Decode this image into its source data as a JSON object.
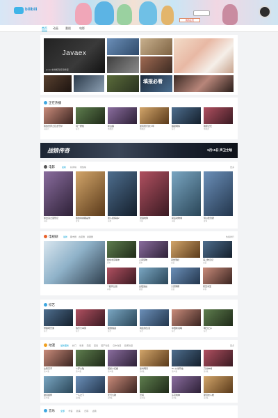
{
  "brand": {
    "logo_text": "bilibili",
    "user_badge": "我的主页"
  },
  "nav": {
    "tabs": [
      "首页",
      "动画",
      "番剧",
      "电影"
    ]
  },
  "hero": {
    "main_title": "Javaex",
    "main_sub": "javaex前端框架使用教程",
    "big_caption": "填报必看"
  },
  "sections": {
    "hot": {
      "title": "正在热播",
      "items": [
        {
          "t": "我的世界之巨龙守护",
          "s": "动画片"
        },
        {
          "t": "同一屋檐",
          "s": "综艺"
        },
        {
          "t": "新白娘",
          "s": "电视剧"
        },
        {
          "t": "逆风而行的少年",
          "s": "电视剧"
        },
        {
          "t": "超级网综",
          "s": "综艺"
        },
        {
          "t": "独家记忆",
          "s": "电视剧"
        }
      ]
    },
    "ad": {
      "left": "战狼传奇",
      "right": "9月15日 声卫士映"
    },
    "movies": {
      "title": "电影",
      "subs": [
        "最新",
        "好评榜",
        "周热榜"
      ],
      "more": "更多",
      "items": [
        {
          "t": "熊出没之变形记",
          "s": "动画"
        },
        {
          "t": "我的青春都是你",
          "s": "爱情"
        },
        {
          "t": "唐人街探案2",
          "s": "喜剧"
        },
        {
          "t": "流浪地球",
          "s": "科幻"
        },
        {
          "t": "疯狂动物城",
          "s": "动画"
        },
        {
          "t": "何以笙箫默",
          "s": "爱情"
        }
      ]
    },
    "tv": {
      "title": "电视剧",
      "subs": [
        "最新",
        "都市剧",
        "古装剧",
        "悬疑剧"
      ],
      "more": "热播排行",
      "items": [
        {
          "t": "我在北京等你",
          "s": "都市"
        },
        {
          "t": "人间至味",
          "s": "都市"
        },
        {
          "t": "双世宠妃",
          "s": "古装"
        },
        {
          "t": "海上牧云记",
          "s": "古装"
        },
        {
          "t": "一起同过窗",
          "s": "青春"
        },
        {
          "t": "白夜追凶",
          "s": "悬疑"
        },
        {
          "t": "大唐荣耀",
          "s": "古装"
        },
        {
          "t": "夏至未至",
          "s": "青春"
        }
      ]
    },
    "variety": {
      "title": "综艺",
      "items": [
        {
          "t": "奔跑吧兄弟",
          "s": "综艺"
        },
        {
          "t": "快乐大本营",
          "s": "综艺"
        },
        {
          "t": "极限挑战",
          "s": "综艺"
        },
        {
          "t": "向往的生活",
          "s": "综艺"
        },
        {
          "t": "中国新说唱",
          "s": "综艺"
        },
        {
          "t": "明日之子",
          "s": "综艺"
        }
      ]
    },
    "anime": {
      "title": "动漫",
      "subs": [
        "最新更新",
        "热门",
        "新番",
        "完结",
        "连载",
        "国产动漫",
        "日本动漫",
        "欧美动漫"
      ],
      "more": "更多",
      "items": [
        {
          "t": "全职高手",
          "s": "第12集"
        },
        {
          "t": "斗罗大陆",
          "s": "第24集"
        },
        {
          "t": "狐妖小红娘",
          "s": "第10集"
        },
        {
          "t": "秦时明月",
          "s": "第8集"
        },
        {
          "t": "Re:从零开始",
          "s": "第25集"
        },
        {
          "t": "刀剑神域",
          "s": "第3集"
        },
        {
          "t": "魔道祖师",
          "s": "第15集"
        },
        {
          "t": "一人之下",
          "s": "第6集"
        },
        {
          "t": "天行九歌",
          "s": "第5集"
        },
        {
          "t": "灵契",
          "s": "第11集"
        },
        {
          "t": "东京喰种",
          "s": "第7集"
        },
        {
          "t": "夏目友人帐",
          "s": "第4集"
        }
      ]
    },
    "music": {
      "title": "音乐",
      "subs": [
        "全部",
        "华语",
        "欧美",
        "日韩",
        "古典"
      ]
    }
  }
}
